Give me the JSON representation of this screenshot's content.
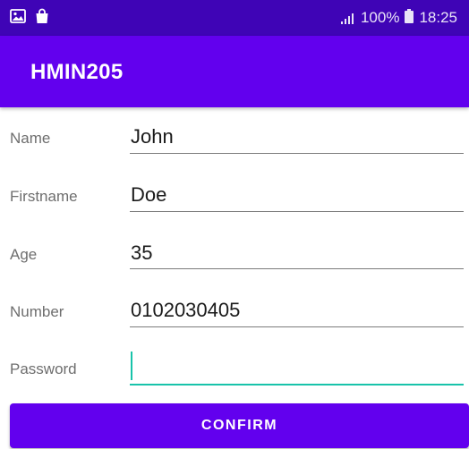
{
  "status_bar": {
    "left_icons": [
      "image-icon",
      "shopping-bag-icon"
    ],
    "battery_percent": "100%",
    "time": "18:25"
  },
  "app_bar": {
    "title": "HMIN205"
  },
  "form": {
    "name": {
      "label": "Name",
      "value": "John"
    },
    "firstname": {
      "label": "Firstname",
      "value": "Doe"
    },
    "age": {
      "label": "Age",
      "value": "35"
    },
    "number": {
      "label": "Number",
      "value": "0102030405"
    },
    "password": {
      "label": "Password",
      "value": ""
    }
  },
  "confirm_button": {
    "label": "CONFIRM"
  },
  "colors": {
    "status_bar": "#3f04b6",
    "primary": "#6200ee",
    "accent": "#18c3aa"
  }
}
